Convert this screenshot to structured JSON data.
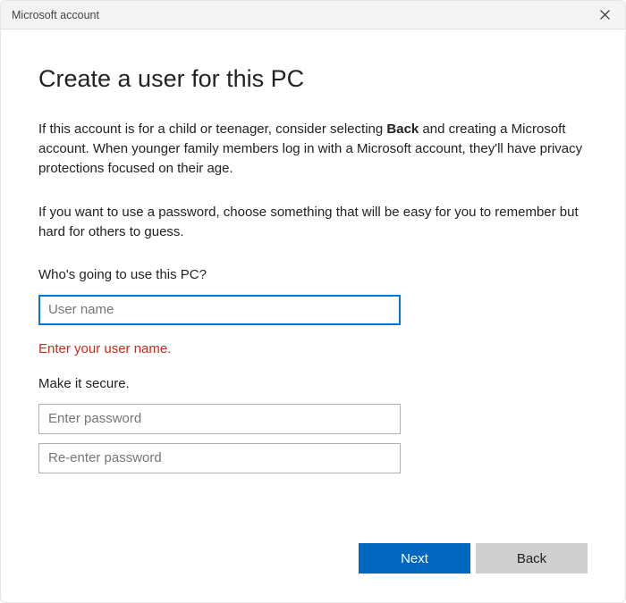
{
  "titlebar": {
    "title": "Microsoft account"
  },
  "main": {
    "heading": "Create a user for this PC",
    "paragraph1_a": "If this account is for a child or teenager, consider selecting ",
    "paragraph1_bold": "Back",
    "paragraph1_b": " and creating a Microsoft account. When younger family members log in with a Microsoft account, they'll have privacy protections focused on their age.",
    "paragraph2": "If you want to use a password, choose something that will be easy for you to remember but hard for others to guess.",
    "section1_label": "Who's going to use this PC?",
    "username_placeholder": "User name",
    "username_value": "",
    "error": "Enter your user name.",
    "section2_label": "Make it secure.",
    "password_placeholder": "Enter password",
    "password_value": "",
    "password2_placeholder": "Re-enter password",
    "password2_value": ""
  },
  "footer": {
    "next_label": "Next",
    "back_label": "Back"
  }
}
